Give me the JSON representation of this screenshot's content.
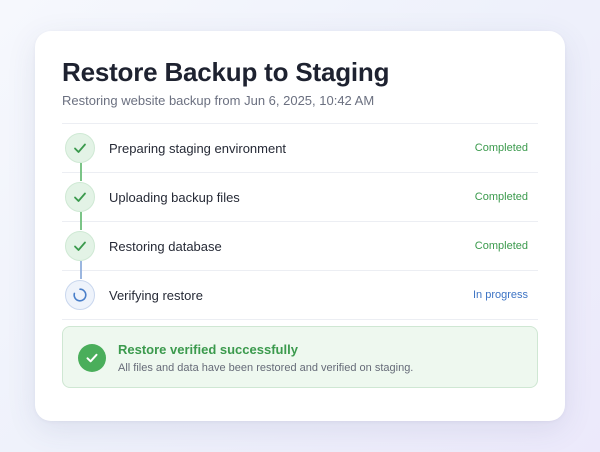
{
  "card": {
    "title": "Restore Backup to Staging",
    "subtitle": "Restoring website backup from Jun 6, 2025, 10:42 AM"
  },
  "steps": [
    {
      "label": "Preparing staging environment",
      "status": "Completed",
      "state": "done"
    },
    {
      "label": "Uploading backup files",
      "status": "Completed",
      "state": "done"
    },
    {
      "label": "Restoring database",
      "status": "Completed",
      "state": "done"
    },
    {
      "label": "Verifying restore",
      "status": "In progress",
      "state": "in-progress"
    }
  ],
  "success": {
    "title": "Restore verified successfully",
    "description": "All files and data have been restored and verified on staging.",
    "icon": "check-circle-icon"
  },
  "colors": {
    "success_green": "#4aae5b",
    "status_green": "#3b9a4d",
    "status_blue": "#3d74c4"
  }
}
